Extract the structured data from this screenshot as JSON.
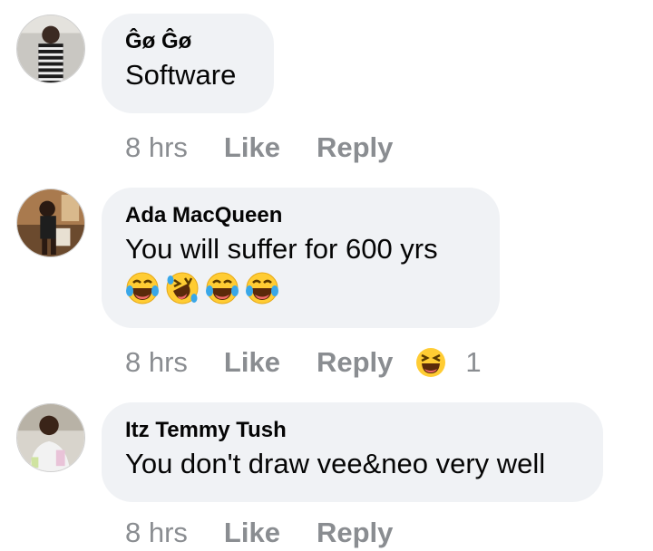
{
  "comments": [
    {
      "author": "Ĝø Ĝø",
      "text": "Software",
      "time": "8 hrs",
      "like_label": "Like",
      "reply_label": "Reply"
    },
    {
      "author": "Ada MacQueen",
      "text": "You will suffer for 600 yrs",
      "emojis": [
        "laughing-tears-emoji",
        "rolling-laughing-emoji",
        "laughing-tears-emoji",
        "laughing-tears-emoji"
      ],
      "time": "8 hrs",
      "like_label": "Like",
      "reply_label": "Reply",
      "reaction_icon": "haha-reaction-icon",
      "reaction_count": "1"
    },
    {
      "author": "Itz Temmy Tush",
      "text": "You don't draw vee&neo very well",
      "time": "8 hrs",
      "like_label": "Like",
      "reply_label": "Reply"
    }
  ],
  "colors": {
    "bubble": "#f0f2f5",
    "text": "#050505",
    "meta": "#8a8d91",
    "emoji_face": "#ffcc33",
    "emoji_tear": "#39a7e8"
  }
}
